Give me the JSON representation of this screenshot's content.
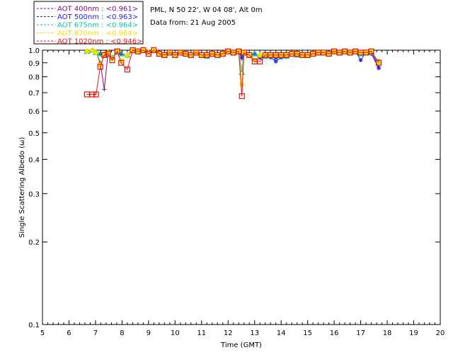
{
  "chart_data": {
    "type": "line",
    "title": "PML, N 50 22', W 04 08', Alt 0m",
    "subtitle": "Data from: 21 Aug 2005",
    "xlabel": "Time (GMT)",
    "ylabel": "Single Scattering Albedo (ω)",
    "xlim": [
      5,
      20
    ],
    "ylim": [
      0.1,
      1.0
    ],
    "yscale": "log",
    "grid": false,
    "legend_position": "top-left-outside",
    "x_ticks": [
      "5",
      "6",
      "7",
      "8",
      "9",
      "10",
      "11",
      "12",
      "13",
      "14",
      "15",
      "16",
      "17",
      "18",
      "19",
      "20"
    ],
    "y_ticks": [
      "0.1",
      "0.2",
      "0.3",
      "0.4",
      "0.5",
      "0.6",
      "0.7",
      "0.8",
      "0.9",
      "1.0"
    ],
    "x": [
      6.68,
      6.88,
      7.02,
      7.18,
      7.33,
      7.47,
      7.63,
      7.82,
      7.97,
      8.2,
      8.4,
      8.6,
      8.8,
      9.0,
      9.2,
      9.4,
      9.6,
      9.8,
      10.0,
      10.2,
      10.4,
      10.6,
      10.8,
      11.0,
      11.2,
      11.4,
      11.6,
      11.8,
      12.0,
      12.2,
      12.4,
      12.52,
      12.6,
      12.8,
      13.0,
      13.2,
      13.4,
      13.6,
      13.8,
      14.0,
      14.2,
      14.4,
      14.6,
      14.8,
      15.0,
      15.2,
      15.4,
      15.6,
      15.8,
      16.0,
      16.2,
      16.4,
      16.6,
      16.8,
      17.0,
      17.2,
      17.4,
      17.68
    ],
    "series": [
      {
        "name": "AOT  400nm : <0.961>",
        "color": "#7b0b7b",
        "marker": "cross",
        "values": [
          0.99,
          1.0,
          0.98,
          0.9,
          0.72,
          0.97,
          0.93,
          0.99,
          0.97,
          0.95,
          1.0,
          0.99,
          1.0,
          0.98,
          1.0,
          0.97,
          0.96,
          0.98,
          0.96,
          0.98,
          0.97,
          0.96,
          0.98,
          0.96,
          0.96,
          0.97,
          0.96,
          0.97,
          0.99,
          0.98,
          0.99,
          0.93,
          0.98,
          0.96,
          0.97,
          0.94,
          0.96,
          0.95,
          0.93,
          0.95,
          0.96,
          0.97,
          0.97,
          0.96,
          0.96,
          0.97,
          0.98,
          0.98,
          0.97,
          0.99,
          0.98,
          0.99,
          0.98,
          0.99,
          0.98,
          0.98,
          0.99,
          0.87
        ]
      },
      {
        "name": "AOT  500nm : <0.963>",
        "color": "#2020e0",
        "marker": "asterisk",
        "values": [
          0.99,
          1.0,
          0.98,
          0.97,
          0.96,
          0.97,
          0.94,
          0.99,
          0.97,
          0.96,
          1.0,
          0.99,
          1.0,
          0.98,
          1.0,
          0.97,
          0.96,
          0.98,
          0.96,
          0.98,
          0.97,
          0.96,
          0.98,
          0.96,
          0.95,
          0.97,
          0.96,
          0.97,
          0.99,
          0.98,
          0.99,
          0.94,
          0.98,
          0.96,
          0.97,
          0.94,
          0.95,
          0.94,
          0.91,
          0.94,
          0.95,
          0.97,
          0.96,
          0.96,
          0.96,
          0.97,
          0.98,
          0.98,
          0.97,
          0.99,
          0.98,
          0.99,
          0.98,
          0.99,
          0.92,
          0.98,
          0.97,
          0.86
        ]
      },
      {
        "name": "AOT  675nm : <0.964>",
        "color": "#00c8a0",
        "marker": "triangle",
        "values": [
          0.99,
          1.0,
          0.98,
          0.97,
          0.97,
          0.97,
          0.94,
          0.99,
          0.97,
          0.96,
          1.0,
          0.99,
          1.0,
          0.98,
          1.0,
          0.97,
          0.96,
          0.98,
          0.96,
          0.98,
          0.97,
          0.96,
          0.98,
          0.96,
          0.95,
          0.97,
          0.96,
          0.97,
          0.99,
          0.98,
          0.99,
          0.83,
          0.98,
          0.96,
          0.97,
          0.96,
          0.95,
          0.96,
          0.94,
          0.96,
          0.95,
          0.97,
          0.96,
          0.96,
          0.96,
          0.97,
          0.98,
          0.98,
          0.97,
          0.99,
          0.98,
          0.99,
          0.98,
          0.99,
          0.97,
          0.98,
          0.98,
          0.91
        ]
      },
      {
        "name": "AOT  870nm : <0.964>",
        "color": "#f0e000",
        "marker": "diamond",
        "values": [
          0.99,
          1.0,
          0.98,
          0.88,
          0.97,
          0.98,
          0.93,
          0.99,
          0.91,
          0.96,
          1.0,
          0.99,
          1.0,
          0.98,
          1.0,
          0.97,
          0.96,
          0.98,
          0.96,
          0.98,
          0.97,
          0.96,
          0.98,
          0.96,
          0.96,
          0.97,
          0.96,
          0.97,
          0.99,
          0.98,
          0.99,
          0.75,
          0.98,
          0.96,
          0.92,
          0.96,
          0.96,
          0.96,
          0.96,
          0.96,
          0.96,
          0.97,
          0.97,
          0.96,
          0.96,
          0.97,
          0.98,
          0.98,
          0.97,
          0.99,
          0.98,
          0.99,
          0.98,
          0.99,
          0.98,
          0.98,
          0.99,
          0.9
        ]
      },
      {
        "name": "AOT 1020nm : <0.946>",
        "color": "#e81010",
        "marker": "square",
        "values": [
          0.69,
          0.69,
          0.69,
          0.87,
          0.96,
          0.97,
          0.92,
          0.99,
          0.9,
          0.85,
          1.0,
          0.99,
          1.0,
          0.97,
          1.0,
          0.97,
          0.96,
          0.98,
          0.96,
          0.98,
          0.97,
          0.96,
          0.98,
          0.96,
          0.96,
          0.97,
          0.96,
          0.97,
          0.99,
          0.98,
          0.99,
          0.68,
          0.98,
          0.96,
          0.91,
          0.91,
          0.96,
          0.96,
          0.96,
          0.96,
          0.96,
          0.97,
          0.97,
          0.96,
          0.96,
          0.97,
          0.98,
          0.98,
          0.97,
          0.99,
          0.98,
          0.99,
          0.98,
          0.99,
          0.98,
          0.98,
          0.99,
          0.9
        ]
      }
    ]
  }
}
